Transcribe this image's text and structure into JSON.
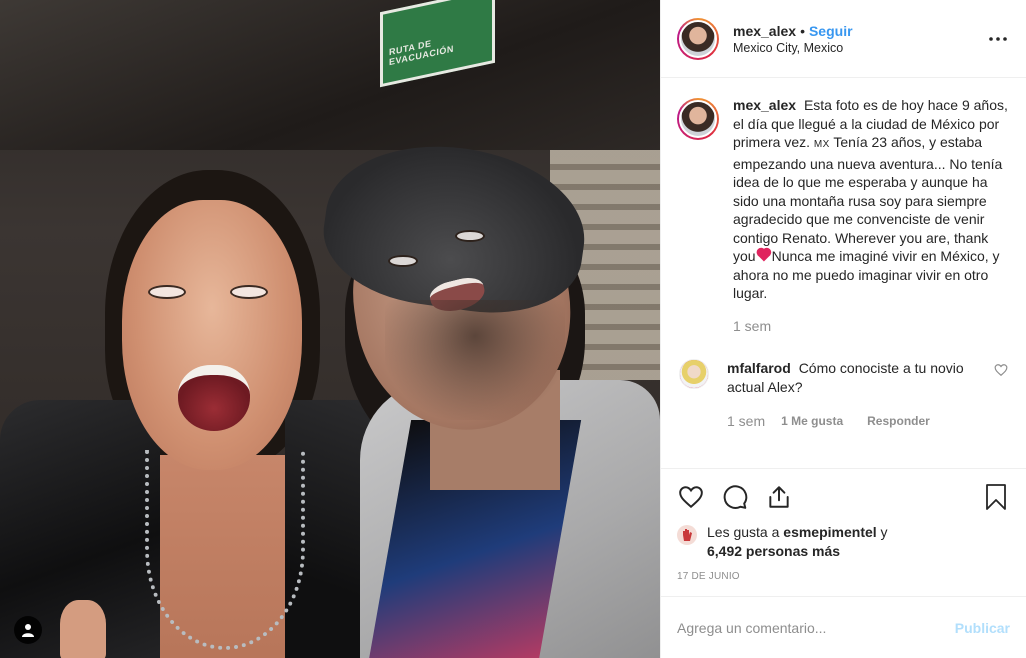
{
  "photo": {
    "sign_text": "RUTA DE EVACUACIÓN",
    "user_tag_icon": "user-icon"
  },
  "header": {
    "username": "mex_alex",
    "separator": "•",
    "follow_label": "Seguir",
    "location": "Mexico City, Mexico",
    "more_icon": "more-horizontal-icon"
  },
  "caption": {
    "username": "mex_alex",
    "text_part1": "Esta foto es de hoy hace 9 años, el día que llegué a la ciudad de México por primera vez.",
    "flag": "MX",
    "text_part2": "Tenía 23 años, y estaba empezando una nueva aventura... No tenía idea de lo que me esperaba y aunque ha sido una montaña rusa soy para siempre agradecido que me convenciste de venir contigo Renato. Wherever you are, thank you",
    "text_part3": "Nunca me imaginé vivir en México, y ahora no me puedo imaginar vivir en otro lugar.",
    "time": "1 sem"
  },
  "comment": {
    "username": "mfalfarod",
    "text": "Cómo conociste a tu novio actual Alex?",
    "time": "1 sem",
    "likes": "1 Me gusta",
    "reply": "Responder"
  },
  "actions": {
    "icons": [
      "heart-icon",
      "comment-icon",
      "share-icon",
      "bookmark-icon"
    ]
  },
  "likes": {
    "prefix": "Les gusta a",
    "user": "esmepimentel",
    "joiner": "y",
    "others": "6,492 personas más"
  },
  "date": "17 DE JUNIO",
  "add_comment": {
    "placeholder": "Agrega un comentario...",
    "post_label": "Publicar"
  },
  "colors": {
    "accent": "#3897f0",
    "post_disabled": "#b2dffc",
    "muted": "#8e8e8e",
    "text": "#262626"
  }
}
